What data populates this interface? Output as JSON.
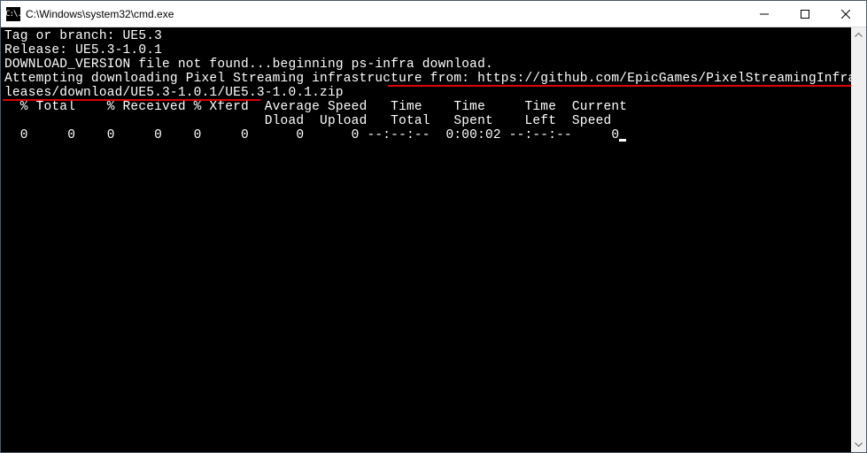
{
  "titlebar": {
    "icon_text": "C:\\.",
    "title": "C:\\Windows\\system32\\cmd.exe"
  },
  "terminal": {
    "line1": "Tag or branch: UE5.3",
    "line2": "Release: UE5.3-1.0.1",
    "line3": "DOWNLOAD_VERSION file not found...beginning ps-infra download.",
    "line4": "Attempting downloading Pixel Streaming infrastructure from: https://github.com/EpicGames/PixelStreamingInfrastructure/re",
    "line5": "leases/download/UE5.3-1.0.1/UE5.3-1.0.1.zip",
    "line6": "  % Total    % Received % Xferd  Average Speed   Time    Time     Time  Current",
    "line7": "                                 Dload  Upload   Total   Spent    Left  Speed",
    "line8": "  0     0    0     0    0     0      0      0 --:--:--  0:00:02 --:--:--     0"
  }
}
